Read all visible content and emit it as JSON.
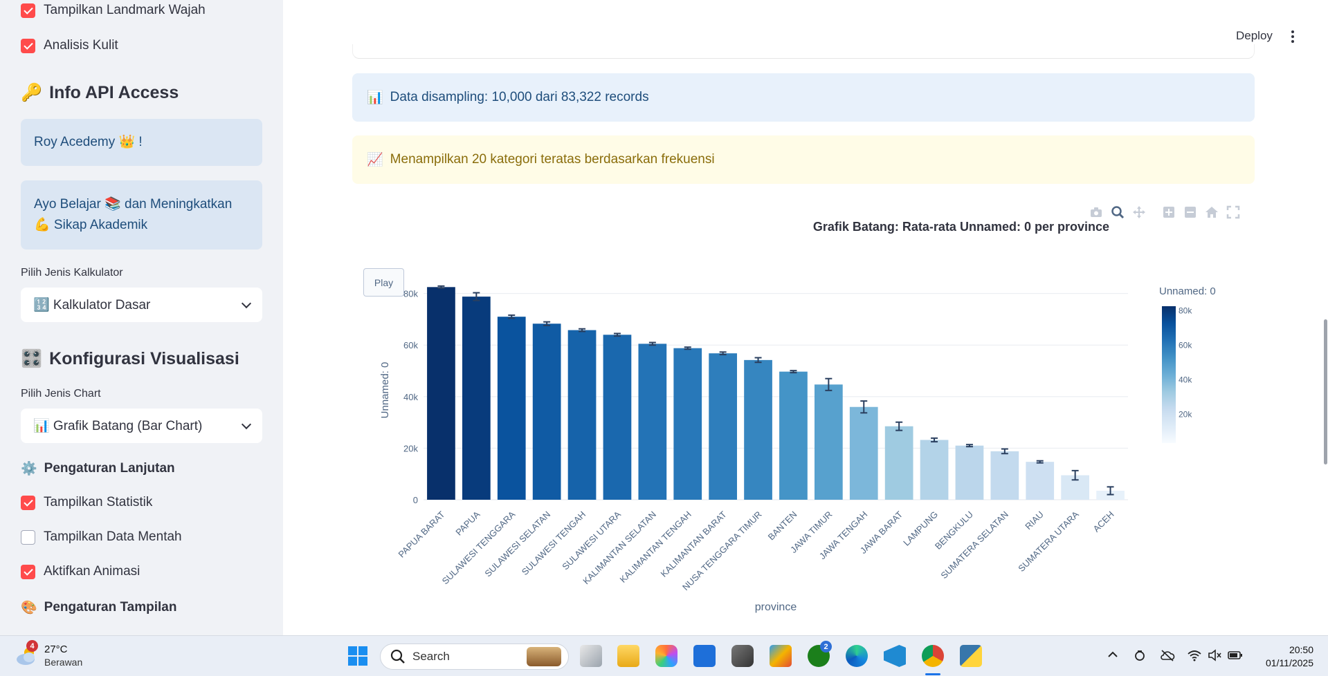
{
  "sidebar": {
    "checkbox_landmark": "Tampilkan Landmark Wajah",
    "checkbox_skin": "Analisis Kulit",
    "api_title": "Info API Access",
    "api_box_1": "Roy Acedemy 👑 !",
    "api_box_2_line1": "Ayo Belajar 📚 dan Meningkatkan",
    "api_box_2_line2": "💪 Sikap Akademik",
    "calc_label": "Pilih Jenis Kalkulator",
    "calc_value": "🔢 Kalkulator Dasar",
    "viz_title": "Konfigurasi Visualisasi",
    "chart_label": "Pilih Jenis Chart",
    "chart_value": "📊 Grafik Batang (Bar Chart)",
    "advanced_title": "Pengaturan Lanjutan",
    "cb_stats": "Tampilkan Statistik",
    "cb_raw": "Tampilkan Data Mentah",
    "cb_anim": "Aktifkan Animasi",
    "display_title": "Pengaturan Tampilan"
  },
  "header": {
    "deploy": "Deploy"
  },
  "alerts": {
    "sampling": "Data disampling: 10,000 dari 83,322 records",
    "top_categories": "Menampilkan 20 kategori teratas berdasarkan frekuensi"
  },
  "chart_controls": {
    "play": "Play"
  },
  "chart_data": {
    "type": "bar",
    "title": "Grafik Batang: Rata-rata Unnamed: 0 per province",
    "xlabel": "province",
    "ylabel": "Unnamed: 0",
    "ylim": [
      0,
      85000
    ],
    "yticks": [
      0,
      20000,
      40000,
      60000,
      80000
    ],
    "ytick_labels": [
      "0",
      "20k",
      "40k",
      "60k",
      "80k"
    ],
    "colorbar_title": "Unnamed: 0",
    "colorbar_ticks": [
      "80k",
      "60k",
      "40k",
      "20k"
    ],
    "colorscale": "Blues",
    "categories": [
      "PAPUA BARAT",
      "PAPUA",
      "SULAWESI TENGGARA",
      "SULAWESI SELATAN",
      "SULAWESI TENGAH",
      "SULAWESI UTARA",
      "KALIMANTAN SELATAN",
      "KALIMANTAN TENGAH",
      "KALIMANTAN BARAT",
      "NUSA TENGGARA TIMUR",
      "BANTEN",
      "JAWA TIMUR",
      "JAWA TENGAH",
      "JAWA BARAT",
      "LAMPUNG",
      "BENGKULU",
      "SUMATERA SELATAN",
      "RIAU",
      "SUMATERA UTARA",
      "ACEH"
    ],
    "values": [
      82500,
      78800,
      71000,
      68300,
      65800,
      64000,
      60500,
      58800,
      56800,
      54200,
      49700,
      44700,
      36000,
      28500,
      23200,
      21000,
      18800,
      14700,
      9500,
      3500
    ],
    "errors": [
      400,
      1500,
      600,
      700,
      500,
      500,
      500,
      400,
      500,
      900,
      400,
      2300,
      2300,
      1600,
      700,
      400,
      900,
      400,
      1800,
      1500
    ],
    "grid": true
  },
  "taskbar": {
    "weather_temp": "27°C",
    "weather_cond": "Berawan",
    "weather_badge": "4",
    "search": "Search",
    "xbox_badge": "2",
    "time": "20:50",
    "date": "01/11/2025"
  },
  "colors": {
    "accent": "#ff4b4b",
    "sidebar_bg": "#f0f2f6",
    "info_bg": "#dbe6f3",
    "alert_blue_bg": "#e8f1fb",
    "alert_yellow_bg": "#fffce7"
  }
}
